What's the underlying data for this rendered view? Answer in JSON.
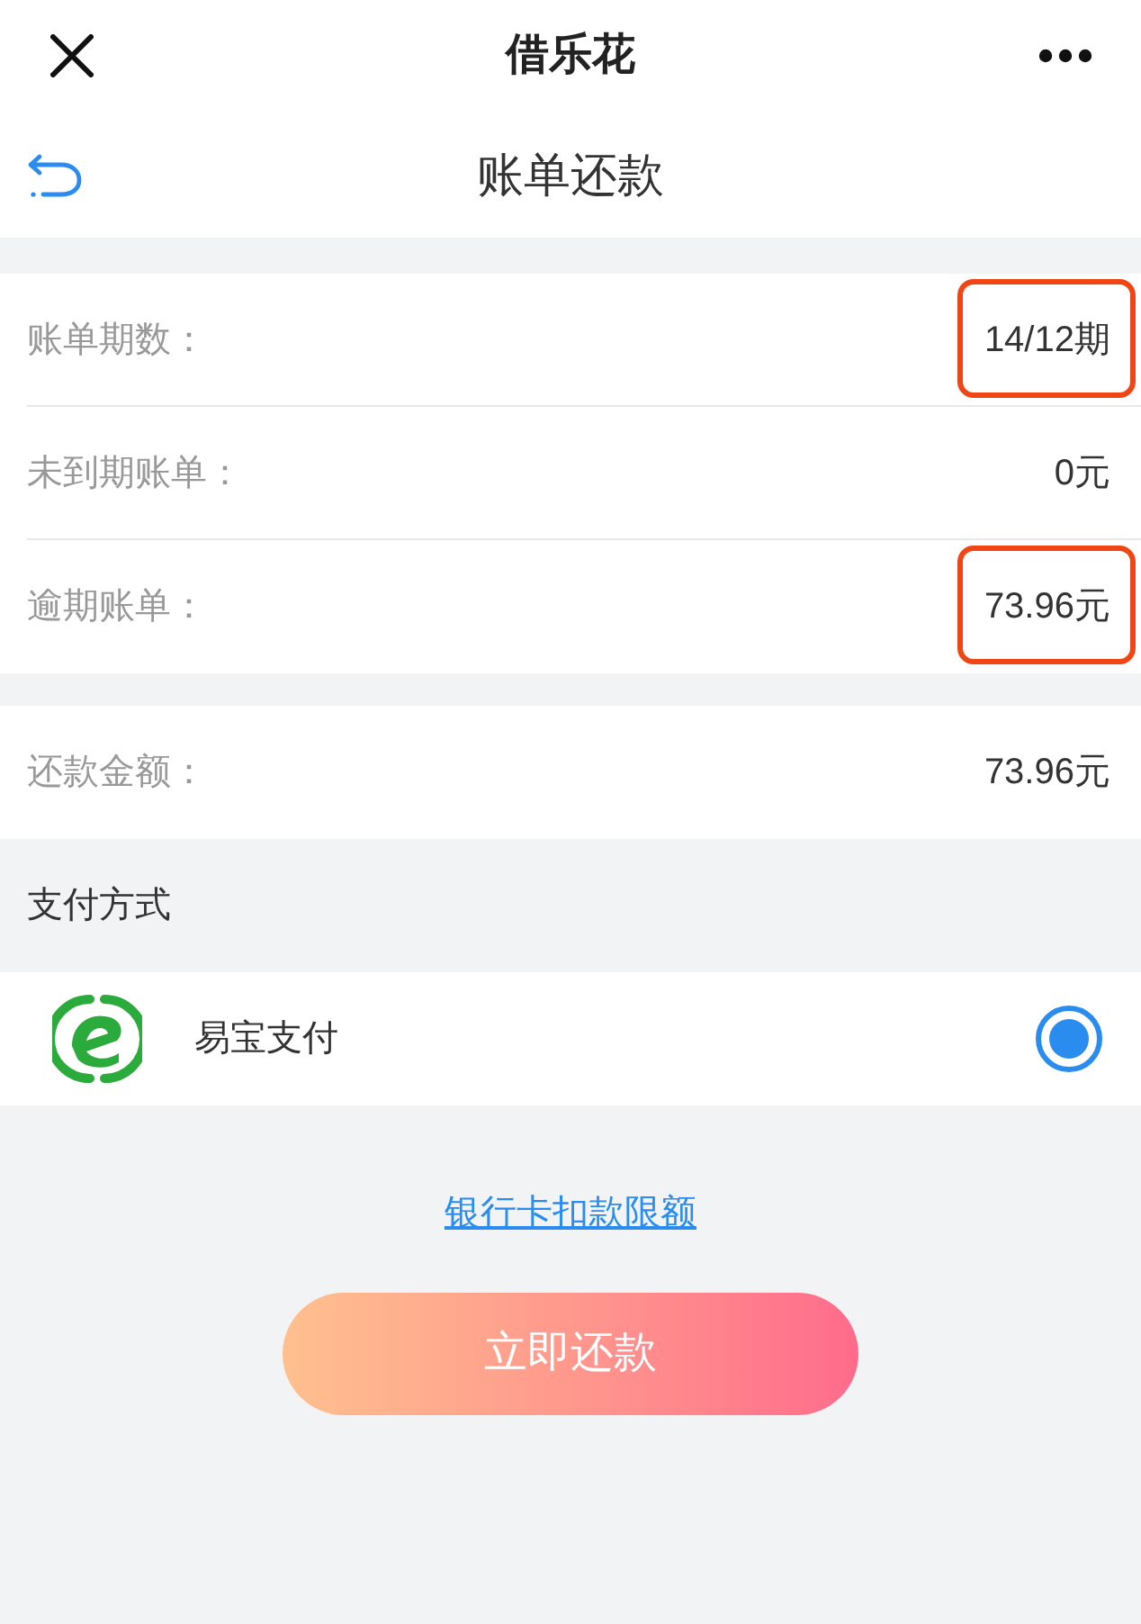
{
  "top_bar": {
    "title": "借乐花"
  },
  "nav_bar": {
    "title": "账单还款"
  },
  "bill_rows": [
    {
      "label": "账单期数：",
      "value": "14/12期",
      "highlighted": true
    },
    {
      "label": "未到期账单：",
      "value": "0元",
      "highlighted": false
    },
    {
      "label": "逾期账单：",
      "value": "73.96元",
      "highlighted": true
    }
  ],
  "amount_row": {
    "label": "还款金额：",
    "value": "73.96元"
  },
  "payment_section": {
    "title": "支付方式",
    "methods": [
      {
        "name": "易宝支付",
        "selected": true
      }
    ]
  },
  "limit_link": "银行卡扣款限额",
  "submit_button": "立即还款"
}
